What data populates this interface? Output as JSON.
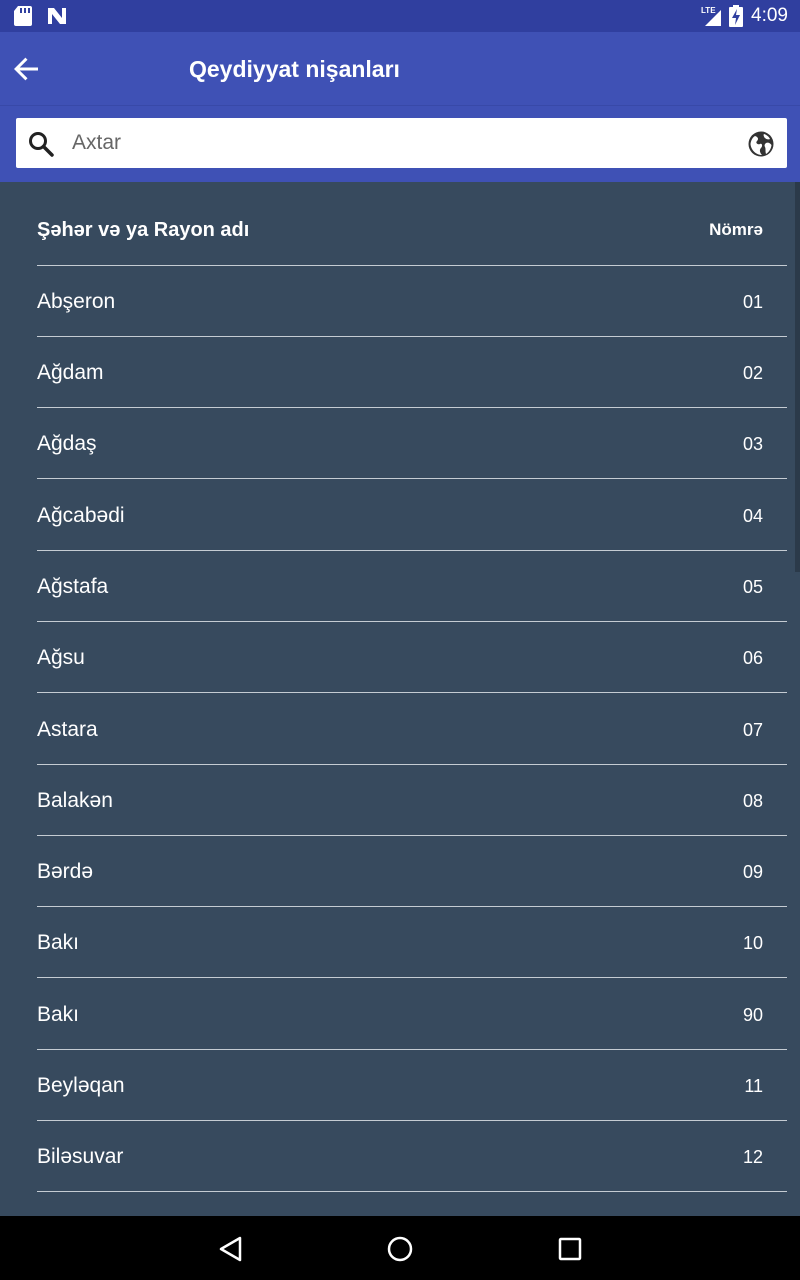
{
  "status_bar": {
    "time": "4:09",
    "network": "LTE",
    "icons": [
      "sd-card-icon",
      "n-icon",
      "signal-icon",
      "battery-charging-icon"
    ]
  },
  "app_bar": {
    "title": "Qeydiyyat nişanları",
    "back_icon": "arrow-left-icon"
  },
  "search": {
    "placeholder": "Axtar",
    "value": "",
    "search_icon": "search-icon",
    "globe_icon": "globe-icon"
  },
  "table": {
    "header": {
      "name": "Şəhər və ya Rayon adı",
      "number": "Nömrə"
    },
    "rows": [
      {
        "name": "Abşeron",
        "number": "01"
      },
      {
        "name": "Ağdam",
        "number": "02"
      },
      {
        "name": "Ağdaş",
        "number": "03"
      },
      {
        "name": "Ağcabədi",
        "number": "04"
      },
      {
        "name": "Ağstafa",
        "number": "05"
      },
      {
        "name": "Ağsu",
        "number": "06"
      },
      {
        "name": "Astara",
        "number": "07"
      },
      {
        "name": "Balakən",
        "number": "08"
      },
      {
        "name": "Bərdə",
        "number": "09"
      },
      {
        "name": "Bakı",
        "number": "10"
      },
      {
        "name": "Bakı",
        "number": "90"
      },
      {
        "name": "Beyləqan",
        "number": "11"
      },
      {
        "name": "Biləsuvar",
        "number": "12"
      }
    ]
  },
  "colors": {
    "status_bar": "#303f9f",
    "app_bar": "#3f51b5",
    "list_background": "#374a5e",
    "divider": "#c5ccd3",
    "nav_bar": "#000000"
  }
}
